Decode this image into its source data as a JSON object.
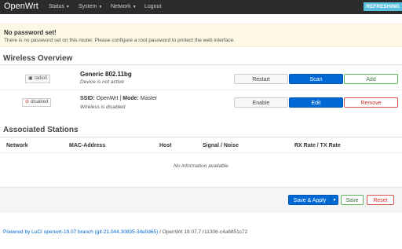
{
  "header": {
    "brand": "OpenWrt",
    "nav": [
      "Status",
      "System",
      "Network",
      "Logout"
    ],
    "refresh_label": "REFRESHING"
  },
  "alert": {
    "title": "No password set!",
    "text": "There is no password set on this router. Please configure a root password to protect the web interface."
  },
  "wireless": {
    "title": "Wireless Overview",
    "device": {
      "badge": "radio0",
      "name": "Generic 802.11bg",
      "status": "Device is not active",
      "buttons": [
        "Restart",
        "Scan",
        "Add"
      ]
    },
    "network": {
      "badge": "disabled",
      "ssid_label": "SSID:",
      "ssid": "OpenWrt",
      "mode_label": "Mode:",
      "mode": "Master",
      "status": "Wireless is disabled",
      "buttons": [
        "Enable",
        "Edit",
        "Remove"
      ]
    }
  },
  "stations": {
    "title": "Associated Stations",
    "columns": [
      "Network",
      "MAC-Address",
      "Host",
      "Signal / Noise",
      "RX Rate / TX Rate"
    ],
    "empty": "No information available"
  },
  "actions": {
    "save_apply": "Save & Apply",
    "save": "Save",
    "reset": "Reset"
  },
  "footer": {
    "powered_by": "Powered by LuCI openwrt-19.07 branch (git-21.044.30835-34e0d65)",
    "version": " / OpenWrt 19.07.7 r11306-c4a6851c72"
  },
  "colors": {
    "navbar": "#2b2b2b",
    "primary": "#0069d6",
    "alert_bg": "#fcf8e3",
    "refresh_bg": "#5bc0de"
  }
}
